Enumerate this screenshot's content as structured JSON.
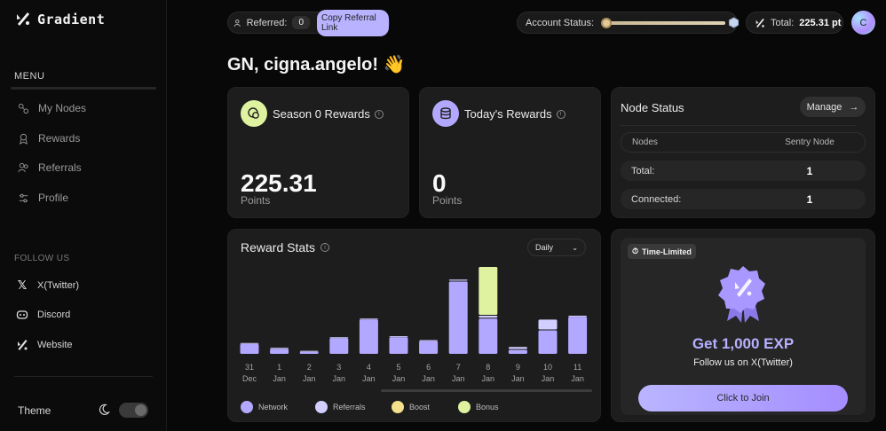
{
  "brand": {
    "name": "Gradient"
  },
  "sidebar": {
    "menu_label": "MENU",
    "items": [
      {
        "label": "My Nodes",
        "icon": "nodes-icon"
      },
      {
        "label": "Rewards",
        "icon": "rewards-icon"
      },
      {
        "label": "Referrals",
        "icon": "referrals-icon"
      },
      {
        "label": "Profile",
        "icon": "profile-icon"
      }
    ],
    "follow_label": "FOLLOW US",
    "follow": [
      {
        "label": "X(Twitter)",
        "icon": "x-icon"
      },
      {
        "label": "Discord",
        "icon": "discord-icon"
      },
      {
        "label": "Website",
        "icon": "website-icon"
      }
    ],
    "theme_label": "Theme"
  },
  "topbar": {
    "referred_label": "Referred:",
    "referred_count": "0",
    "copy_link": "Copy Referral Link",
    "account_status_label": "Account Status:",
    "account_status_level": 0.02,
    "total_label": "Total:",
    "total_value": "225.31 pt",
    "avatar_initial": "C"
  },
  "greeting": "GN, cigna.angelo! 👋",
  "season_rewards": {
    "title": "Season 0 Rewards",
    "value": "225.31",
    "unit": "Points"
  },
  "today_rewards": {
    "title": "Today's Rewards",
    "value": "0",
    "unit": "Points"
  },
  "node_status": {
    "title": "Node Status",
    "manage": "Manage",
    "header": {
      "k": "Nodes",
      "v": "Sentry Node"
    },
    "rows": [
      {
        "k": "Total:",
        "v": "1"
      },
      {
        "k": "Connected:",
        "v": "1"
      }
    ]
  },
  "reward_stats": {
    "title": "Reward Stats",
    "period": "Daily"
  },
  "chart_data": {
    "type": "bar",
    "title": "Reward Stats",
    "categories": [
      "31 Dec",
      "1 Jan",
      "2 Jan",
      "3 Jan",
      "4 Jan",
      "5 Jan",
      "6 Jan",
      "7 Jan",
      "8 Jan",
      "9 Jan",
      "10 Jan",
      "11 Jan"
    ],
    "tick_top": [
      "31",
      "1",
      "2",
      "3",
      "4",
      "5",
      "6",
      "7",
      "8",
      "9",
      "10",
      "11"
    ],
    "tick_bottom": [
      "Dec",
      "Jan",
      "Jan",
      "Jan",
      "Jan",
      "Jan",
      "Jan",
      "Jan",
      "Jan",
      "Jan",
      "Jan",
      "Jan"
    ],
    "series": [
      {
        "name": "Network",
        "color": "#b3a8ff",
        "values": [
          11,
          6,
          3,
          17,
          36,
          18,
          14,
          75,
          37,
          5,
          25,
          39
        ]
      },
      {
        "name": "Referrals",
        "color": "#d2ceff",
        "values": [
          1,
          1,
          1,
          1,
          1,
          1,
          1,
          2,
          3,
          3,
          11,
          1
        ]
      },
      {
        "name": "Boost",
        "color": "#f5e08b",
        "values": [
          0,
          0,
          0,
          0,
          0,
          0,
          0,
          0,
          0,
          0,
          0,
          0
        ]
      },
      {
        "name": "Bonus",
        "color": "#dff2a0",
        "values": [
          0,
          0,
          0,
          0,
          0,
          0,
          0,
          0,
          50,
          0,
          0,
          0
        ]
      }
    ],
    "ylim": [
      0,
      100
    ],
    "grid": false,
    "legend": "bottom"
  },
  "promo": {
    "badge": "Time-Limited",
    "title": "Get 1,000 EXP",
    "subtitle": "Follow us on X(Twitter)",
    "button": "Click to Join"
  },
  "colors": {
    "accent": "#b8b2ff",
    "background": "#080808",
    "card": "#1d1d1d"
  }
}
